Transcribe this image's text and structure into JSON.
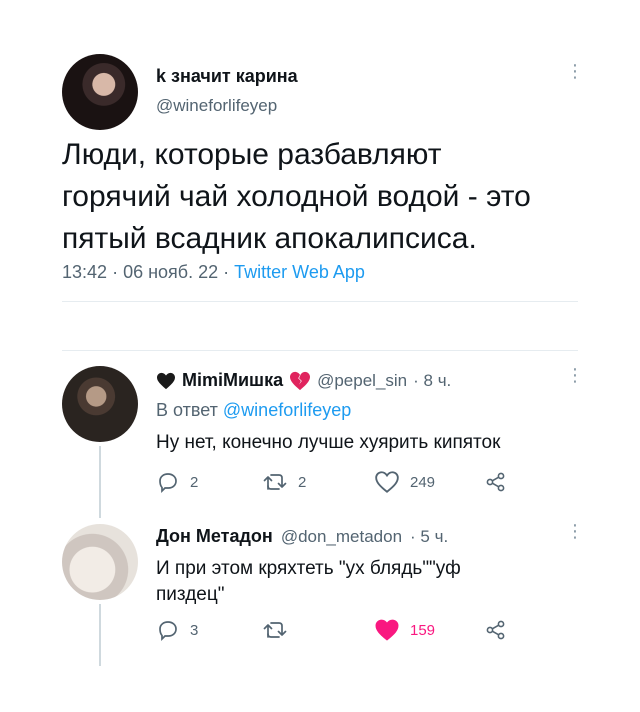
{
  "main_tweet": {
    "display_name": "k значит карина",
    "handle": "@wineforlifeyep",
    "text_lines": [
      "Люди, которые разбавляют",
      "горячий чай холодной водой - это",
      "пятый всадник апокалипсиса."
    ],
    "time": "13:42",
    "date": "06 нояб. 22",
    "sep": "·",
    "source": "Twitter Web App"
  },
  "replies": [
    {
      "display_name": "MimiМишка",
      "handle": "@pepel_sin",
      "age": "· 8 ч.",
      "reply_to_label": "В ответ",
      "reply_to_handle": "@wineforlifeyep",
      "text_lines": [
        "Ну нет, конечно лучше хуярить кипяток"
      ],
      "counts": {
        "reply": "2",
        "retweet": "2",
        "like": "249"
      },
      "liked": false
    },
    {
      "display_name": "Дон Метадон",
      "handle": "@don_metadon",
      "age": "· 5 ч.",
      "text_lines": [
        "И при этом кряхтеть \"ух блядь\"\"уф",
        "пиздец\""
      ],
      "counts": {
        "reply": "3",
        "retweet": "",
        "like": "159"
      },
      "liked": true
    }
  ],
  "icons": {
    "reply": "reply-icon",
    "retweet": "retweet-icon",
    "like": "heart-icon",
    "share": "share-icon",
    "more": "more-icon"
  },
  "colors": {
    "accent": "#1d9bf0",
    "like_active": "#f91880",
    "muted": "#536471"
  }
}
